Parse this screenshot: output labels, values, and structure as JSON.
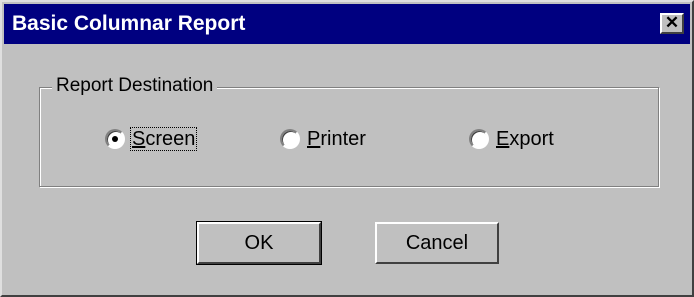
{
  "window": {
    "title": "Basic Columnar Report",
    "close_glyph": "✕"
  },
  "group": {
    "label": "Report Destination"
  },
  "radios": [
    {
      "mnemonic": "S",
      "rest": "creen",
      "selected": true
    },
    {
      "mnemonic": "P",
      "rest": "rinter",
      "selected": false
    },
    {
      "mnemonic": "E",
      "rest": "xport",
      "selected": false
    }
  ],
  "buttons": {
    "ok_label": "OK",
    "cancel_label": "Cancel"
  },
  "colors": {
    "titlebar": "#000080",
    "face": "#c0c0c0"
  }
}
